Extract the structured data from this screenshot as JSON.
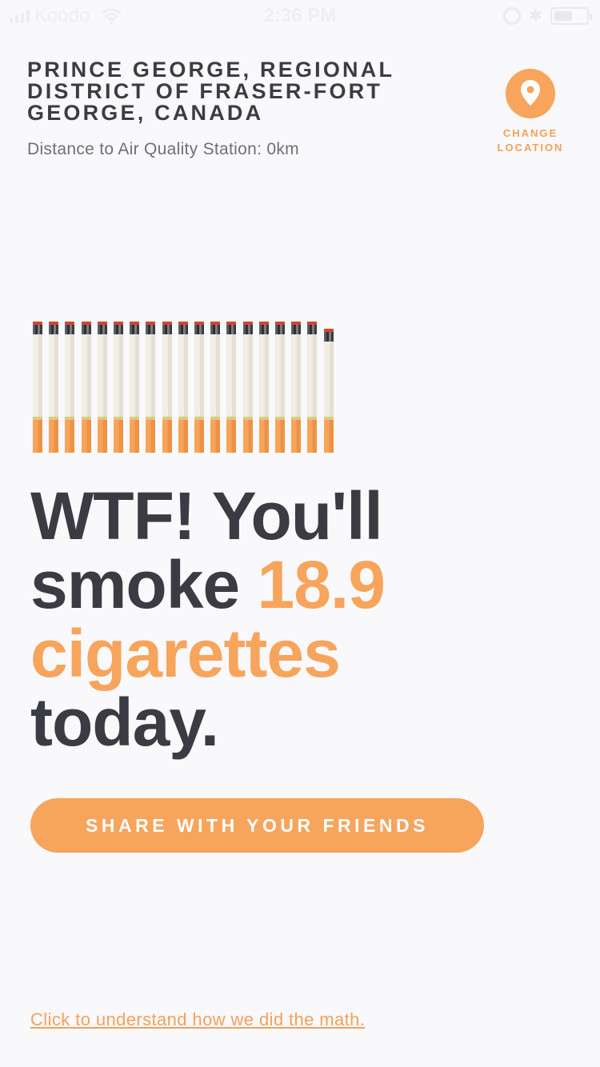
{
  "status_bar": {
    "carrier": "Koodo",
    "time": "2:36 PM",
    "icons": [
      "signal-icon",
      "wifi-icon",
      "rotation-lock-icon",
      "bluetooth-icon",
      "battery-icon"
    ]
  },
  "header": {
    "location": "PRINCE GEORGE, REGIONAL DISTRICT OF FRASER-FORT GEORGE, CANADA",
    "distance": "Distance to Air Quality Station: 0km",
    "change_location_label": "CHANGE LOCATION",
    "change_location_icon": "location-pin-icon"
  },
  "cigarettes": {
    "count": 18.9
  },
  "headline": {
    "part1": "WTF! You'll smoke ",
    "value": "18.9",
    "part2": "cigarettes",
    "part3": "today."
  },
  "share_button": {
    "label": "SHARE WITH YOUR FRIENDS"
  },
  "math_link": {
    "label": "Click to understand how we did the math."
  },
  "colors": {
    "accent": "#f7a45c",
    "text_dark": "#3b3c43",
    "background": "#f9f8fb"
  }
}
